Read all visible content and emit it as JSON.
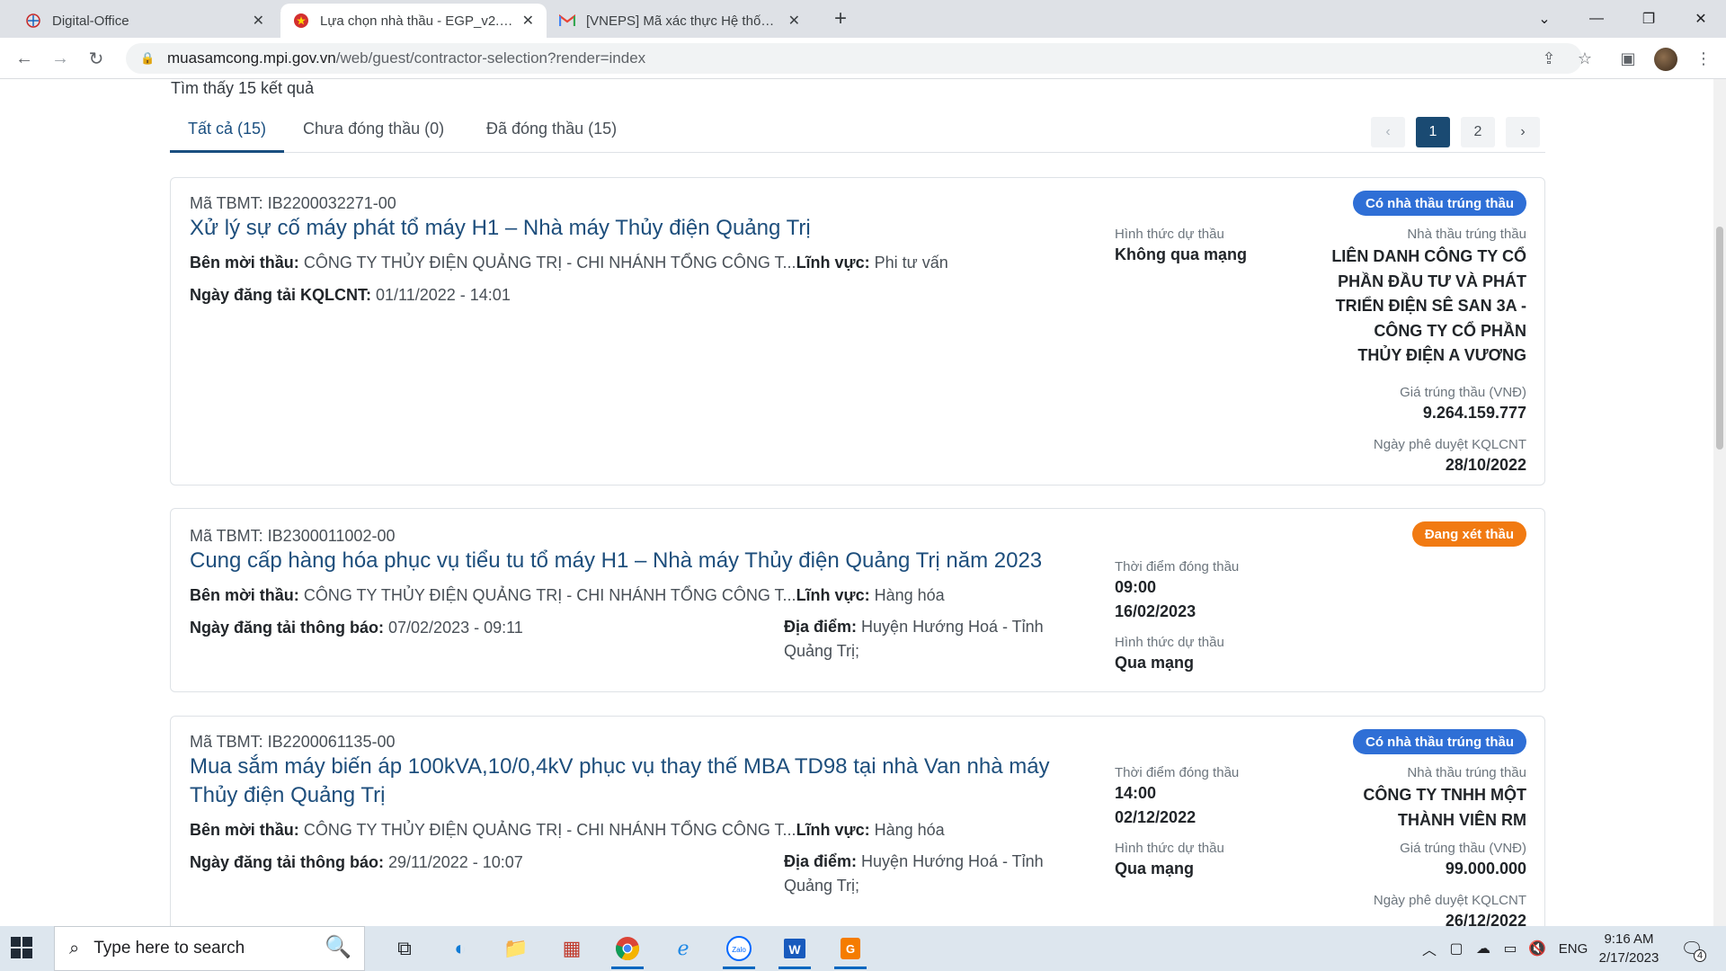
{
  "browser": {
    "tabs": [
      {
        "title": "Digital-Office",
        "active": false
      },
      {
        "title": "Lựa chọn nhà thầu - EGP_v2.0 - E",
        "active": true
      },
      {
        "title": "[VNEPS] Mã xác thực Hệ thống m",
        "active": false
      }
    ],
    "url_host": "muasamcong.mpi.gov.vn",
    "url_path": "/web/guest/contractor-selection?render=index"
  },
  "results": {
    "found_text": "Tìm thấy 15 kết quả",
    "tabs": [
      {
        "label": "Tất cả (15)",
        "active": true
      },
      {
        "label": "Chưa đóng thầu (0)",
        "active": false
      },
      {
        "label": "Đã đóng thầu (15)",
        "active": false
      }
    ],
    "pagination": {
      "prev": "‹",
      "pages": [
        "1",
        "2"
      ],
      "current": "1",
      "next": "›"
    }
  },
  "cards": [
    {
      "code": "Mã TBMT: IB2200032271-00",
      "title": "Xử lý sự cố máy phát tổ máy H1 – Nhà máy Thủy điện Quảng Trị",
      "inviter_label": "Bên mời thầu:",
      "inviter": "CÔNG TY THỦY ĐIỆN QUẢNG TRỊ - CHI NHÁNH TỔNG CÔNG T...",
      "field_label": "Lĩnh vực:",
      "field": "Phi tư vấn",
      "date_label": "Ngày đăng tải KQLCNT:",
      "date": "01/11/2022 - 14:01",
      "mid_label": "Hình thức dự thầu",
      "mid_value": "Không qua mạng",
      "badge": "Có nhà thầu trúng thầu",
      "winner_label": "Nhà thầu trúng thầu",
      "winner_lines": [
        "LIÊN DANH CÔNG TY CỔ",
        "PHẦN ĐẦU TƯ VÀ PHÁT",
        "TRIỂN ĐIỆN SÊ SAN 3A -",
        "CÔNG TY CỔ PHẦN",
        "THỦY ĐIỆN A VƯƠNG"
      ],
      "price_label": "Giá trúng thầu (VNĐ)",
      "price": "9.264.159.777",
      "approve_label": "Ngày phê duyệt KQLCNT",
      "approve_date": "28/10/2022"
    },
    {
      "code": "Mã TBMT: IB2300011002-00",
      "title": "Cung cấp hàng hóa phục vụ tiểu tu tổ máy H1 – Nhà máy Thủy điện Quảng Trị năm 2023",
      "inviter_label": "Bên mời thầu:",
      "inviter": "CÔNG TY THỦY ĐIỆN QUẢNG TRỊ - CHI NHÁNH TỔNG CÔNG T...",
      "field_label": "Lĩnh vực:",
      "field": "Hàng hóa",
      "date_label": "Ngày đăng tải thông báo:",
      "date": "07/02/2023 - 09:11",
      "location_label": "Địa điểm:",
      "location": "Huyện Hướng Hoá - Tỉnh Quảng Trị;",
      "close_label": "Thời điểm đóng thầu",
      "close_time": "09:00",
      "close_date": "16/02/2023",
      "mid_label": "Hình thức dự thầu",
      "mid_value": "Qua mạng",
      "badge": "Đang xét thầu"
    },
    {
      "code": "Mã TBMT: IB2200061135-00",
      "title": "Mua sắm máy biến áp 100kVA,10/0,4kV phục vụ thay thế MBA TD98 tại nhà Van nhà máy Thủy điện Quảng Trị",
      "inviter_label": "Bên mời thầu:",
      "inviter": "CÔNG TY THỦY ĐIỆN QUẢNG TRỊ - CHI NHÁNH TỔNG CÔNG T...",
      "field_label": "Lĩnh vực:",
      "field": "Hàng hóa",
      "date_label": "Ngày đăng tải thông báo:",
      "date": "29/11/2022 - 10:07",
      "location_label": "Địa điểm:",
      "location": "Huyện Hướng Hoá - Tỉnh Quảng Trị;",
      "close_label": "Thời điểm đóng thầu",
      "close_time": "14:00",
      "close_date": "02/12/2022",
      "mid_label": "Hình thức dự thầu",
      "mid_value": "Qua mạng",
      "badge": "Có nhà thầu trúng thầu",
      "winner_label": "Nhà thầu trúng thầu",
      "winner_lines": [
        "CÔNG TY TNHH MỘT",
        "THÀNH VIÊN RM"
      ],
      "price_label": "Giá trúng thầu (VNĐ)",
      "price": "99.000.000",
      "approve_label": "Ngày phê duyệt KQLCNT",
      "approve_date": "26/12/2022"
    }
  ],
  "taskbar": {
    "search_placeholder": "Type here to search",
    "lang": "ENG",
    "time": "9:16 AM",
    "date": "2/17/2023",
    "notif_count": "4"
  },
  "colors": {
    "accent": "#1a4a72",
    "badge_blue": "#2f6fd6",
    "badge_orange": "#f17a12"
  }
}
